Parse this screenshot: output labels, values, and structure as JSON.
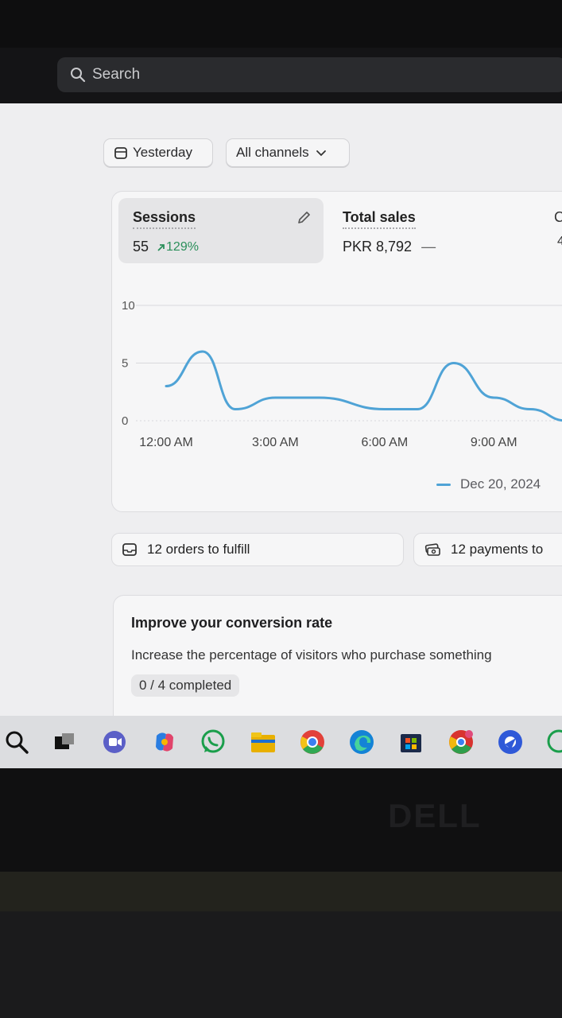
{
  "search": {
    "placeholder": "Search"
  },
  "filters": {
    "date_label": "Yesterday",
    "channel_label": "All channels"
  },
  "metrics": {
    "sessions": {
      "title": "Sessions",
      "value": "55",
      "delta": "129%"
    },
    "total_sales": {
      "title": "Total sales",
      "value": "PKR 8,792",
      "delta": "—"
    },
    "cut_title_char": "C",
    "cut_value_char": "4"
  },
  "chart_data": {
    "type": "line",
    "xlabel": "",
    "ylabel": "",
    "ylim": [
      0,
      10
    ],
    "y_ticks": [
      "10",
      "5",
      "0"
    ],
    "x_ticks": [
      "12:00 AM",
      "3:00 AM",
      "6:00 AM",
      "9:00 AM"
    ],
    "grid": true,
    "legend_position": "bottom-right",
    "series": [
      {
        "name": "Dec 20, 2024",
        "color": "#4fa3d6",
        "x": [
          0,
          1,
          1.9,
          3,
          4.2,
          6,
          6.9,
          7.9,
          9,
          10,
          11
        ],
        "values": [
          3,
          6,
          1,
          2,
          2,
          1,
          1,
          5,
          2,
          1,
          0
        ]
      }
    ]
  },
  "tasks": {
    "orders_label": "12 orders to fulfill",
    "payments_label": "12 payments to"
  },
  "conversion": {
    "title": "Improve your conversion rate",
    "description": "Increase the percentage of visitors who purchase something",
    "progress": "0 / 4 completed"
  },
  "taskbar": {
    "icons": [
      "search-icon",
      "task-view-icon",
      "teams-icon",
      "copilot-icon",
      "whatsapp-icon",
      "file-explorer-icon",
      "chrome-icon",
      "edge-icon",
      "store-icon",
      "chrome-canary-icon",
      "browser-icon",
      "whatsapp-icon"
    ]
  },
  "device": {
    "brand": "DELL"
  }
}
